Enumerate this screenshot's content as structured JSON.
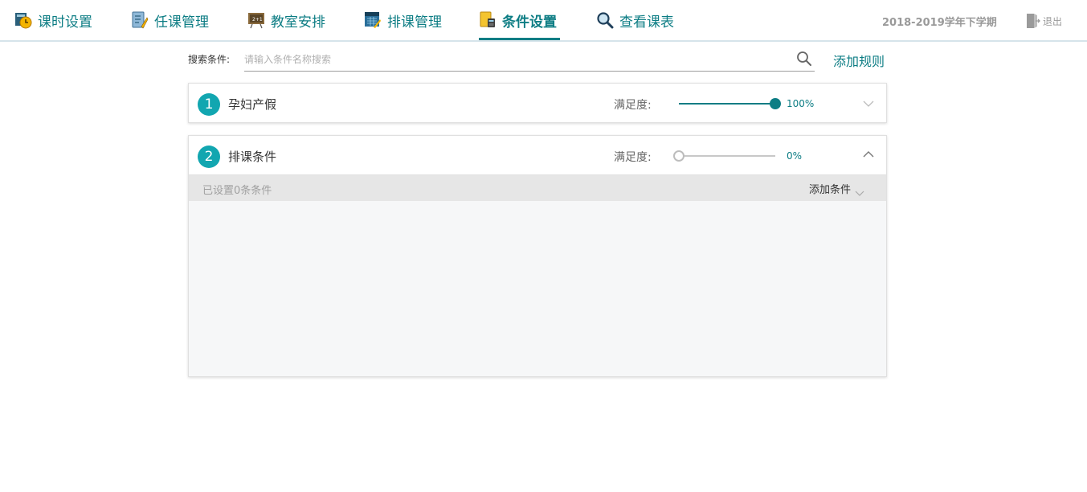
{
  "nav": {
    "items": [
      {
        "label": "课时设置",
        "icon": "clock-icon"
      },
      {
        "label": "任课管理",
        "icon": "teacher-assign-icon"
      },
      {
        "label": "教室安排",
        "icon": "blackboard-icon"
      },
      {
        "label": "排课管理",
        "icon": "schedule-grid-icon"
      },
      {
        "label": "条件设置",
        "icon": "condition-doc-icon",
        "active": true
      },
      {
        "label": "查看课表",
        "icon": "magnifier-icon"
      }
    ],
    "term": "2018-2019学年下学期",
    "logout_label": "退出"
  },
  "search": {
    "label": "搜索条件:",
    "placeholder": "请输入条件名称搜索",
    "value": "",
    "add_rule_label": "添加规则"
  },
  "rules": [
    {
      "index": "1",
      "name": "孕妇产假",
      "satisfaction_label": "满足度:",
      "satisfaction": 100,
      "satisfaction_text": "100%",
      "expanded": false
    },
    {
      "index": "2",
      "name": "排课条件",
      "satisfaction_label": "满足度:",
      "satisfaction": 0,
      "satisfaction_text": "0%",
      "expanded": true,
      "condition_count_text": "已设置0条条件",
      "add_condition_label": "添加条件"
    }
  ],
  "colors": {
    "accent": "#0d7d84",
    "badge": "#12a6b0"
  }
}
